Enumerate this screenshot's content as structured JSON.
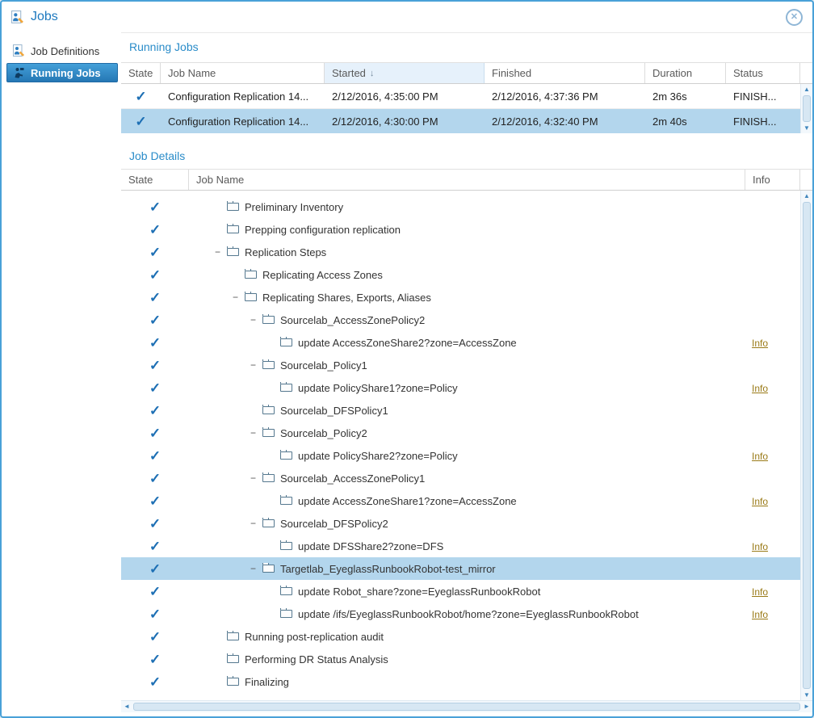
{
  "window": {
    "title": "Jobs"
  },
  "icons": {
    "check": "✓",
    "collapse": "−",
    "sort_desc": "↓",
    "up": "▲",
    "down": "▼",
    "left": "◄",
    "right": "►",
    "close": "✕"
  },
  "colors": {
    "window_border": "#49a1d8",
    "accent_blue": "#2a8cc9",
    "selection_blue": "#b3d6ed",
    "check_blue": "#1d6fb4",
    "info_link": "#9a7a17",
    "sidebar_selected": "#2f86c4"
  },
  "sidebar": {
    "items": [
      {
        "label": "Job Definitions",
        "icon": "job-definitions-icon",
        "selected": false
      },
      {
        "label": "Running Jobs",
        "icon": "running-jobs-icon",
        "selected": true
      }
    ]
  },
  "running_jobs": {
    "section_title": "Running Jobs",
    "columns": [
      "State",
      "Job Name",
      "Started",
      "Finished",
      "Duration",
      "Status"
    ],
    "sorted_column": "Started",
    "rows": [
      {
        "state": "check",
        "job_name": "Configuration Replication 14...",
        "started": "2/12/2016, 4:35:00 PM",
        "finished": "2/12/2016, 4:37:36 PM",
        "duration": "2m 36s",
        "status": "FINISH...",
        "selected": false
      },
      {
        "state": "check",
        "job_name": "Configuration Replication 14...",
        "started": "2/12/2016, 4:30:00 PM",
        "finished": "2/12/2016, 4:32:40 PM",
        "duration": "2m 40s",
        "status": "FINISH...",
        "selected": true
      }
    ]
  },
  "job_details": {
    "section_title": "Job Details",
    "columns": [
      "State",
      "Job Name",
      "Info"
    ],
    "info_label": "Info",
    "rows": [
      {
        "label": "Preliminary Inventory",
        "level": 1,
        "expander": false,
        "info": false,
        "selected": false
      },
      {
        "label": "Prepping configuration replication",
        "level": 1,
        "expander": false,
        "info": false,
        "selected": false
      },
      {
        "label": "Replication Steps",
        "level": 1,
        "expander": true,
        "info": false,
        "selected": false
      },
      {
        "label": "Replicating Access Zones",
        "level": 2,
        "expander": false,
        "info": false,
        "selected": false
      },
      {
        "label": "Replicating Shares, Exports, Aliases",
        "level": 2,
        "expander": true,
        "info": false,
        "selected": false
      },
      {
        "label": "Sourcelab_AccessZonePolicy2",
        "level": 3,
        "expander": true,
        "info": false,
        "selected": false
      },
      {
        "label": "update AccessZoneShare2?zone=AccessZone",
        "level": 4,
        "expander": false,
        "info": true,
        "selected": false
      },
      {
        "label": "Sourcelab_Policy1",
        "level": 3,
        "expander": true,
        "info": false,
        "selected": false
      },
      {
        "label": "update PolicyShare1?zone=Policy",
        "level": 4,
        "expander": false,
        "info": true,
        "selected": false
      },
      {
        "label": "Sourcelab_DFSPolicy1",
        "level": 3,
        "expander": false,
        "info": false,
        "selected": false
      },
      {
        "label": "Sourcelab_Policy2",
        "level": 3,
        "expander": true,
        "info": false,
        "selected": false
      },
      {
        "label": "update PolicyShare2?zone=Policy",
        "level": 4,
        "expander": false,
        "info": true,
        "selected": false
      },
      {
        "label": "Sourcelab_AccessZonePolicy1",
        "level": 3,
        "expander": true,
        "info": false,
        "selected": false
      },
      {
        "label": "update AccessZoneShare1?zone=AccessZone",
        "level": 4,
        "expander": false,
        "info": true,
        "selected": false
      },
      {
        "label": "Sourcelab_DFSPolicy2",
        "level": 3,
        "expander": true,
        "info": false,
        "selected": false
      },
      {
        "label": "update DFSShare2?zone=DFS",
        "level": 4,
        "expander": false,
        "info": true,
        "selected": false
      },
      {
        "label": "Targetlab_EyeglassRunbookRobot-test_mirror",
        "level": 3,
        "expander": true,
        "info": false,
        "selected": true
      },
      {
        "label": "update Robot_share?zone=EyeglassRunbookRobot",
        "level": 4,
        "expander": false,
        "info": true,
        "selected": false
      },
      {
        "label": "update /ifs/EyeglassRunbookRobot/home?zone=EyeglassRunbookRobot",
        "level": 4,
        "expander": false,
        "info": true,
        "selected": false
      },
      {
        "label": "Running post-replication audit",
        "level": 1,
        "expander": false,
        "info": false,
        "selected": false
      },
      {
        "label": "Performing DR Status Analysis",
        "level": 1,
        "expander": false,
        "info": false,
        "selected": false
      },
      {
        "label": "Finalizing",
        "level": 1,
        "expander": false,
        "info": false,
        "selected": false
      }
    ]
  }
}
